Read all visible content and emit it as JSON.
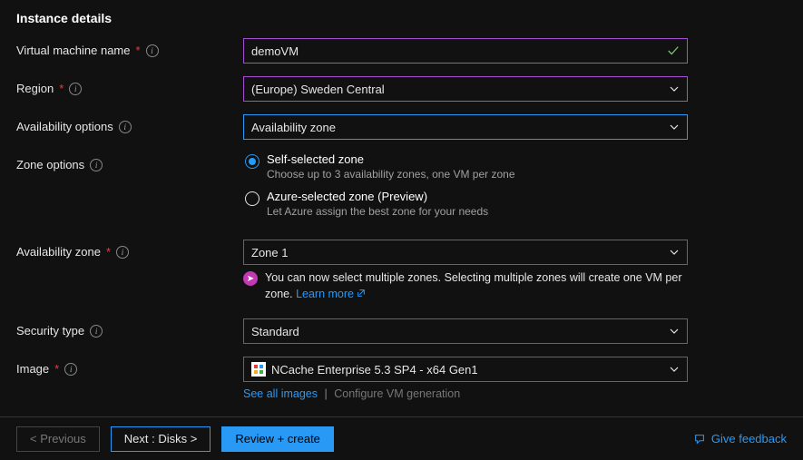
{
  "section": {
    "title": "Instance details"
  },
  "labels": {
    "vmName": "Virtual machine name",
    "region": "Region",
    "availOptions": "Availability options",
    "zoneOptions": "Zone options",
    "availZone": "Availability zone",
    "securityType": "Security type",
    "image": "Image"
  },
  "fields": {
    "vmName": {
      "value": "demoVM"
    },
    "region": {
      "value": "(Europe) Sweden Central"
    },
    "availOptions": {
      "value": "Availability zone"
    },
    "availZone": {
      "value": "Zone 1"
    },
    "securityType": {
      "value": "Standard"
    },
    "image": {
      "value": "NCache Enterprise 5.3 SP4 - x64 Gen1"
    }
  },
  "zoneOptions": {
    "self": {
      "label": "Self-selected zone",
      "desc": "Choose up to 3 availability zones, one VM per zone"
    },
    "azure": {
      "label": "Azure-selected zone (Preview)",
      "desc": "Let Azure assign the best zone for your needs"
    }
  },
  "tip": {
    "text": "You can now select multiple zones. Selecting multiple zones will create one VM per zone. ",
    "linkLabel": "Learn more"
  },
  "imageLinks": {
    "seeAll": "See all images",
    "configure": "Configure VM generation"
  },
  "footer": {
    "prev": "< Previous",
    "next": "Next : Disks >",
    "review": "Review + create",
    "feedback": "Give feedback"
  },
  "glyphs": {
    "req": "*",
    "sep": "|",
    "tipArrow": "➤"
  }
}
